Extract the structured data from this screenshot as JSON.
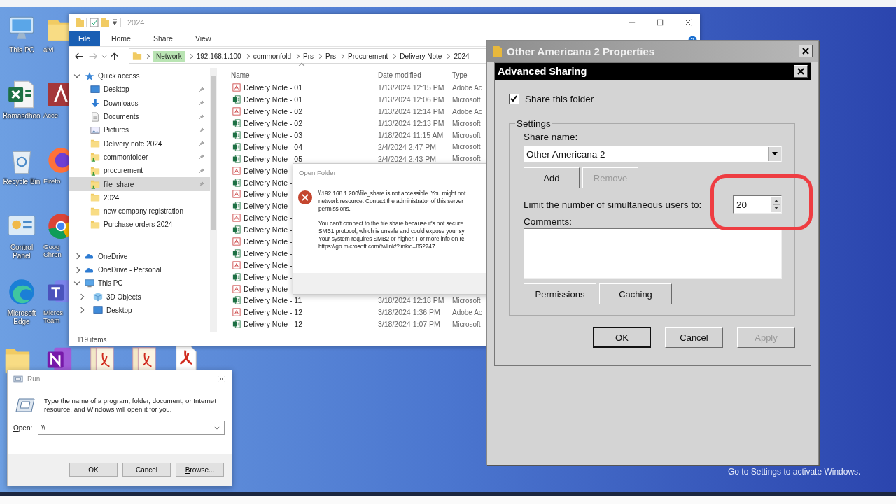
{
  "desktop_icons": [
    {
      "label": "This PC",
      "kind": "pc"
    },
    {
      "label": "Bomasdhoo",
      "kind": "excel"
    },
    {
      "label": "Recycle Bin",
      "kind": "recycle"
    },
    {
      "label": "Control Panel",
      "kind": "control"
    },
    {
      "label": "Microsoft Edge",
      "kind": "edge"
    },
    {
      "label": "alvi",
      "kind": "folder"
    },
    {
      "label": "Acce",
      "kind": "access"
    },
    {
      "label": "Firefo",
      "kind": "firefox"
    },
    {
      "label": "Goog Chron",
      "kind": "chrome"
    },
    {
      "label": "Micros Team",
      "kind": "teams"
    }
  ],
  "desktop_icons_bottom": [
    {
      "kind": "folder"
    },
    {
      "kind": "onenote"
    },
    {
      "kind": "pdfstack"
    },
    {
      "kind": "pdfstack"
    },
    {
      "kind": "pdf"
    }
  ],
  "explorer": {
    "title": "2024",
    "ribbon_tabs": [
      {
        "label": "File",
        "selected": true
      },
      {
        "label": "Home",
        "selected": false
      },
      {
        "label": "Share",
        "selected": false
      },
      {
        "label": "View",
        "selected": false
      }
    ],
    "breadcrumb": [
      {
        "label": "Network",
        "highlighted": true
      },
      {
        "label": "192.168.1.100",
        "highlighted": false
      },
      {
        "label": "commonfold",
        "highlighted": false
      },
      {
        "label": "Prs",
        "highlighted": false
      },
      {
        "label": "Prs",
        "highlighted": false
      },
      {
        "label": "Procurement",
        "highlighted": false
      },
      {
        "label": "Delivery Note",
        "highlighted": false
      },
      {
        "label": "2024",
        "highlighted": false
      }
    ],
    "nav": [
      {
        "label": "Quick access",
        "kind": "star",
        "expanded": true,
        "selected": false,
        "children": [
          {
            "label": "Desktop",
            "kind": "desktop",
            "pinned": true,
            "selected": false
          },
          {
            "label": "Downloads",
            "kind": "download",
            "pinned": true,
            "selected": false
          },
          {
            "label": "Documents",
            "kind": "document",
            "pinned": true,
            "selected": false
          },
          {
            "label": "Pictures",
            "kind": "picture",
            "pinned": true,
            "selected": false
          },
          {
            "label": "Delivery note 2024",
            "kind": "folder",
            "pinned": true,
            "selected": false
          },
          {
            "label": "commonfolder",
            "kind": "share",
            "pinned": true,
            "selected": false
          },
          {
            "label": "procurement",
            "kind": "share",
            "pinned": true,
            "selected": false
          },
          {
            "label": "file_share",
            "kind": "share",
            "pinned": true,
            "selected": true
          },
          {
            "label": "2024",
            "kind": "folder",
            "pinned": false,
            "selected": false
          },
          {
            "label": "new company registration",
            "kind": "folder",
            "pinned": false,
            "selected": false
          },
          {
            "label": "Purchase orders 2024",
            "kind": "folder",
            "pinned": false,
            "selected": false
          }
        ]
      },
      {
        "label": "OneDrive",
        "kind": "cloud",
        "expanded": false,
        "selected": false
      },
      {
        "label": "OneDrive - Personal",
        "kind": "cloud",
        "expanded": false,
        "selected": false
      },
      {
        "label": "This PC",
        "kind": "pc",
        "expanded": true,
        "selected": false,
        "children": [
          {
            "label": "3D Objects",
            "kind": "cube",
            "expanded": false,
            "selected": false
          },
          {
            "label": "Desktop",
            "kind": "desktop",
            "expanded": false,
            "selected": false
          }
        ]
      }
    ],
    "columns": [
      "Name",
      "Date modified",
      "Type"
    ],
    "files": [
      {
        "name": "Delivery Note - 01",
        "kind": "pdf",
        "date": "1/13/2024 12:15 PM",
        "type": "Adobe Ac"
      },
      {
        "name": "Delivery Note - 01",
        "kind": "xlsx",
        "date": "1/13/2024 12:06 PM",
        "type": "Microsoft"
      },
      {
        "name": "Delivery Note - 02",
        "kind": "pdf",
        "date": "1/13/2024 12:14 PM",
        "type": "Adobe Ac"
      },
      {
        "name": "Delivery Note - 02",
        "kind": "xlsx",
        "date": "1/13/2024 12:13 PM",
        "type": "Microsoft"
      },
      {
        "name": "Delivery Note - 03",
        "kind": "xlsx",
        "date": "1/18/2024 11:15 AM",
        "type": "Microsoft"
      },
      {
        "name": "Delivery Note - 04",
        "kind": "xlsx",
        "date": "2/4/2024 2:47 PM",
        "type": "Microsoft"
      },
      {
        "name": "Delivery Note - 05",
        "kind": "xlsx",
        "date": "2/4/2024 2:43 PM",
        "type": "Microsoft"
      },
      {
        "name": "Delivery Note -",
        "kind": "pdf"
      },
      {
        "name": "Delivery Note -",
        "kind": "xlsx"
      },
      {
        "name": "Delivery Note -",
        "kind": "pdf"
      },
      {
        "name": "Delivery Note -",
        "kind": "xlsx"
      },
      {
        "name": "Delivery Note -",
        "kind": "pdf"
      },
      {
        "name": "Delivery Note -",
        "kind": "xlsx"
      },
      {
        "name": "Delivery Note -",
        "kind": "pdf"
      },
      {
        "name": "Delivery Note -",
        "kind": "xlsx"
      },
      {
        "name": "Delivery Note -",
        "kind": "pdf"
      },
      {
        "name": "Delivery Note -",
        "kind": "xlsx"
      },
      {
        "name": "Delivery Note -",
        "kind": "pdf"
      },
      {
        "name": "Delivery Note - 11",
        "kind": "xlsx",
        "date": "3/18/2024 12:18 PM",
        "type": "Microsoft"
      },
      {
        "name": "Delivery Note - 12",
        "kind": "pdf",
        "date": "3/18/2024 1:36 PM",
        "type": "Adobe Ac"
      },
      {
        "name": "Delivery Note - 12",
        "kind": "xlsx",
        "date": "3/18/2024 1:07 PM",
        "type": "Microsoft"
      }
    ],
    "status": "119 items"
  },
  "open_folder_dialog": {
    "title": "Open Folder",
    "paragraphs": [
      "\\\\192.168.1.200\\file_share is not accessible. You might not\nnetwork resource. Contact the administrator of this server\npermissions.",
      "You can't connect to the file share because it's not secure\nSMB1 protocol, which is unsafe and could expose your sy\nYour system requires SMB2 or higher. For more info on re\nhttps://go.microsoft.com/fwlink/?linkid=852747"
    ]
  },
  "properties_dialog": {
    "title": "Other Americana 2 Properties",
    "advanced_sharing": {
      "title": "Advanced Sharing",
      "share_folder": {
        "label": "Share this folder",
        "checked": true
      },
      "group_label": "Settings",
      "share_name_label": "Share name:",
      "share_name": "Other Americana 2",
      "name_buttons": [
        {
          "label": "Add",
          "disabled": false
        },
        {
          "label": "Remove",
          "disabled": true
        }
      ],
      "limit_label": "Limit the number of simultaneous users to:",
      "limit": "20",
      "limit_highlighted": true,
      "comments_label": "Comments:",
      "option_buttons": [
        "Permissions",
        "Caching"
      ],
      "footer_buttons": [
        {
          "label": "OK",
          "default": true,
          "disabled": false
        },
        {
          "label": "Cancel",
          "default": false,
          "disabled": false
        },
        {
          "label": "Apply",
          "default": false,
          "disabled": true
        }
      ]
    }
  },
  "run_dialog": {
    "title": "Run",
    "prompt": "Type the name of a program, folder, document, or Internet resource, and Windows will open it for you.",
    "open_label": "Open:",
    "value": "\\\\",
    "buttons": [
      "OK",
      "Cancel",
      "Browse..."
    ]
  },
  "activation_notice": "Go to Settings to activate Windows."
}
